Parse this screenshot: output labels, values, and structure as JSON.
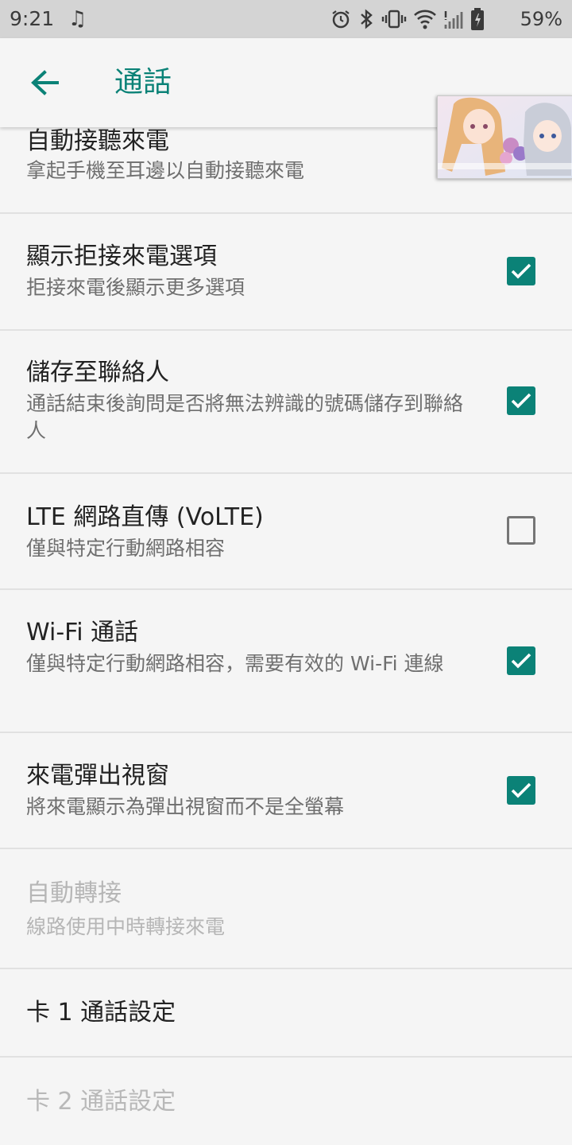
{
  "status_bar": {
    "time": "9:21",
    "battery": "59%",
    "icons": [
      "music-note-icon",
      "alarm-icon",
      "bluetooth-icon",
      "vibrate-icon",
      "wifi-icon",
      "signal-icon",
      "battery-icon"
    ]
  },
  "app_bar": {
    "title": "通話",
    "back_icon": "arrow-back-icon"
  },
  "colors": {
    "accent": "#0b8277",
    "background": "#f5f5f5",
    "status_bar": "#d4d4d4",
    "divider": "#e1e1e1"
  },
  "settings": [
    {
      "title": "自動接聽來電",
      "subtitle": "拿起手機至耳邊以自動接聽來電",
      "checkbox": null,
      "enabled": true
    },
    {
      "title": "顯示拒接來電選項",
      "subtitle": "拒接來電後顯示更多選項",
      "checkbox": true,
      "enabled": true
    },
    {
      "title": "儲存至聯絡人",
      "subtitle": "通話結束後詢問是否將無法辨識的號碼儲存到聯絡人",
      "checkbox": true,
      "enabled": true
    },
    {
      "title": "LTE 網路直傳 (VoLTE)",
      "subtitle": "僅與特定行動網路相容",
      "checkbox": false,
      "enabled": true
    },
    {
      "title": "Wi-Fi 通話",
      "subtitle": "僅與特定行動網路相容，需要有效的 Wi-Fi 連線",
      "checkbox": true,
      "enabled": true
    },
    {
      "title": "來電彈出視窗",
      "subtitle": "將來電顯示為彈出視窗而不是全螢幕",
      "checkbox": true,
      "enabled": true
    },
    {
      "title": "自動轉接",
      "subtitle": "線路使用中時轉接來電",
      "checkbox": null,
      "enabled": false
    },
    {
      "title": "卡 1 通話設定",
      "subtitle": null,
      "checkbox": null,
      "enabled": true
    },
    {
      "title": "卡 2 通話設定",
      "subtitle": null,
      "checkbox": null,
      "enabled": false
    }
  ]
}
